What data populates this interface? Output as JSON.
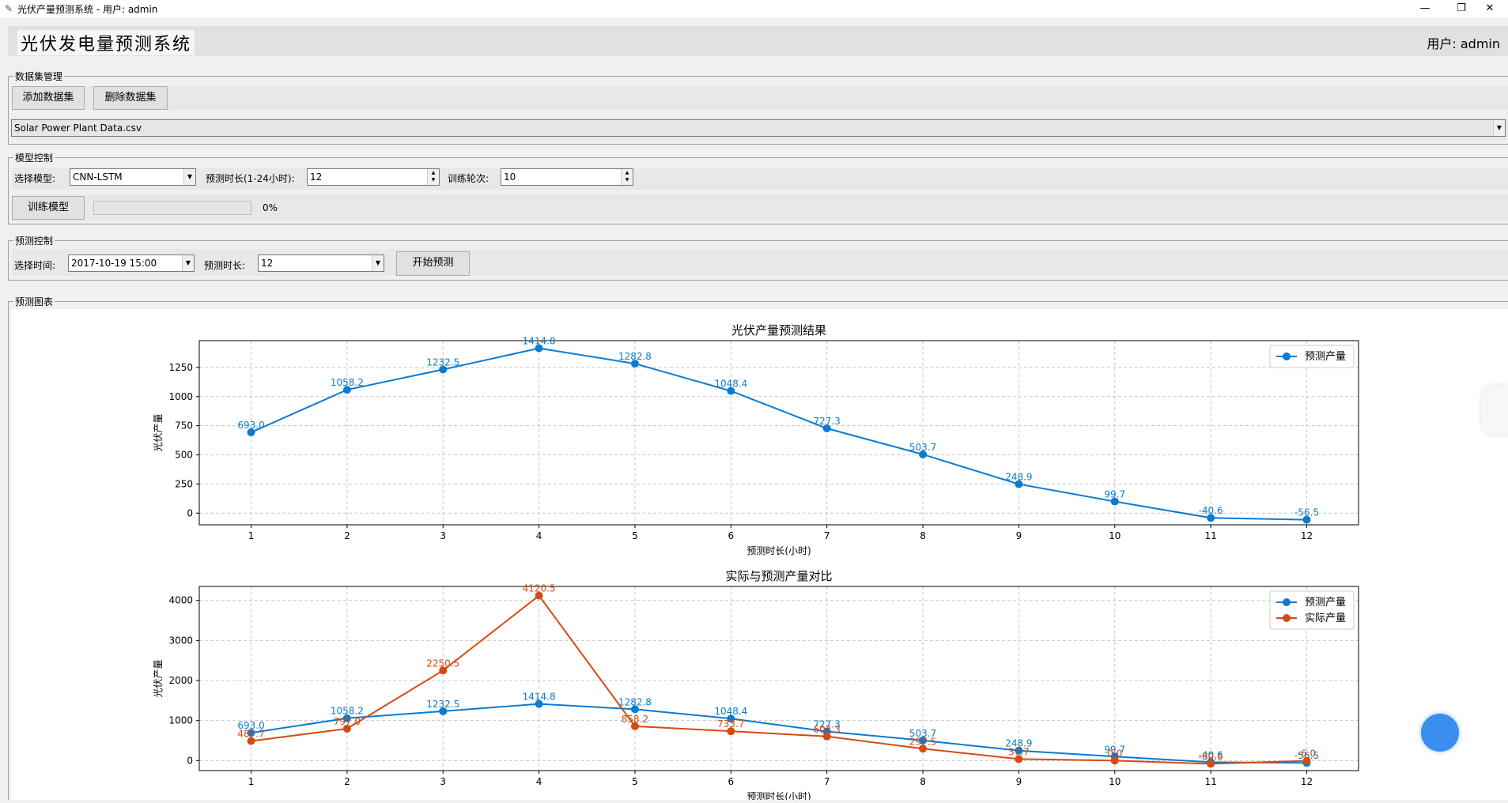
{
  "window": {
    "title": "光伏产量预测系统 - 用户: admin",
    "minimize": "—",
    "restore": "❐",
    "close": "✕"
  },
  "header": {
    "app_title": "光伏发电量预测系统",
    "user": "用户: admin"
  },
  "dataset": {
    "group_label": "数据集管理",
    "add_label": "添加数据集",
    "delete_label": "删除数据集",
    "selected": "Solar Power Plant Data.csv"
  },
  "model": {
    "group_label": "模型控制",
    "select_label": "选择模型:",
    "model_value": "CNN-LSTM",
    "horizon_label": "预测时长(1-24小时):",
    "horizon_value": "12",
    "epochs_label": "训练轮次:",
    "epochs_value": "10",
    "train_label": "训练模型",
    "progress": 0,
    "progress_text": "0%"
  },
  "predict": {
    "group_label": "预测控制",
    "time_label": "选择时间:",
    "time_value": "2017-10-19 15:00",
    "horizon_label": "预测时长:",
    "horizon_value": "12",
    "start_label": "开始预测"
  },
  "charts": {
    "group_label": "预测图表"
  },
  "colors": {
    "predicted": "#0b7ad1",
    "actual": "#d64a12"
  },
  "chart_data": [
    {
      "type": "line",
      "title": "光伏产量预测结果",
      "xlabel": "预测时长(小时)",
      "ylabel": "光伏产量",
      "x": [
        1,
        2,
        3,
        4,
        5,
        6,
        7,
        8,
        9,
        10,
        11,
        12
      ],
      "ylim": [
        -100,
        1480
      ],
      "yticks": [
        0,
        250,
        500,
        750,
        1000,
        1250
      ],
      "grid": true,
      "legend": "top-right",
      "series": [
        {
          "name": "预测产量",
          "values": [
            693.0,
            1058.2,
            1232.5,
            1414.8,
            1282.8,
            1048.4,
            727.3,
            503.7,
            248.9,
            99.7,
            -40.6,
            -56.5
          ],
          "labels": [
            "693.0",
            "1058.2",
            "1232.5",
            "1414.8",
            "1282.8",
            "1048.4",
            "727.3",
            "503.7",
            "248.9",
            "99.7",
            "-40.6",
            "-56.5"
          ]
        }
      ]
    },
    {
      "type": "line",
      "title": "实际与预测产量对比",
      "xlabel": "预测时长(小时)",
      "ylabel": "光伏产量",
      "x": [
        1,
        2,
        3,
        4,
        5,
        6,
        7,
        8,
        9,
        10,
        11,
        12
      ],
      "ylim": [
        -250,
        4350
      ],
      "yticks": [
        0,
        1000,
        2000,
        3000,
        4000
      ],
      "grid": true,
      "legend": "top-right",
      "series": [
        {
          "name": "预测产量",
          "values": [
            693.0,
            1058.2,
            1232.5,
            1414.8,
            1282.8,
            1048.4,
            727.3,
            503.7,
            248.9,
            99.7,
            -40.6,
            -56.5
          ],
          "labels": [
            "693.0",
            "1058.2",
            "1232.5",
            "1414.8",
            "1282.8",
            "1048.4",
            "727.3",
            "503.7",
            "248.9",
            "99.7",
            "-40.6",
            "-56.5"
          ]
        },
        {
          "name": "实际产量",
          "values": [
            487.7,
            797.0,
            2250.5,
            4120.5,
            858.2,
            733.7,
            603.3,
            297.5,
            37.7,
            0.0,
            -80.6,
            -6.0
          ],
          "labels": [
            "487.7",
            "797.0",
            "2250.5",
            "4120.5",
            "858.2",
            "733.7",
            "603.3",
            "297.5",
            "37.7",
            "0.0",
            "-80.6",
            "-6.0"
          ]
        }
      ]
    }
  ]
}
